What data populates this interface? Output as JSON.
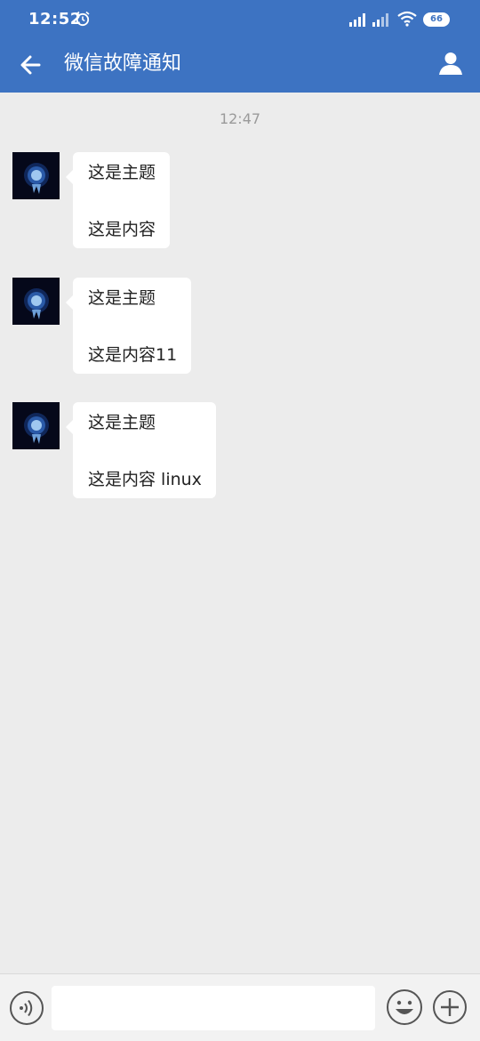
{
  "status_bar": {
    "time": "12:52",
    "battery": "66",
    "icons": [
      "alarm-icon",
      "signal-icon",
      "signal-icon",
      "wifi-icon",
      "battery-icon"
    ]
  },
  "app_bar": {
    "title": "微信故障通知",
    "back_icon": "arrow-left-icon",
    "profile_icon": "person-icon",
    "color": "#3d73c2"
  },
  "chat": {
    "timestamp": "12:47",
    "messages": [
      {
        "subject": "这是主题",
        "content": "这是内容"
      },
      {
        "subject": "这是主题",
        "content": "这是内容11"
      },
      {
        "subject": "这是主题",
        "content": "这是内容 linux"
      }
    ]
  },
  "input_bar": {
    "value": "",
    "placeholder": "",
    "icons": [
      "voice-icon",
      "emoji-icon",
      "plus-icon"
    ]
  },
  "colors": {
    "brand": "#3d73c2",
    "background": "#ececec",
    "bubble": "#ffffff"
  }
}
